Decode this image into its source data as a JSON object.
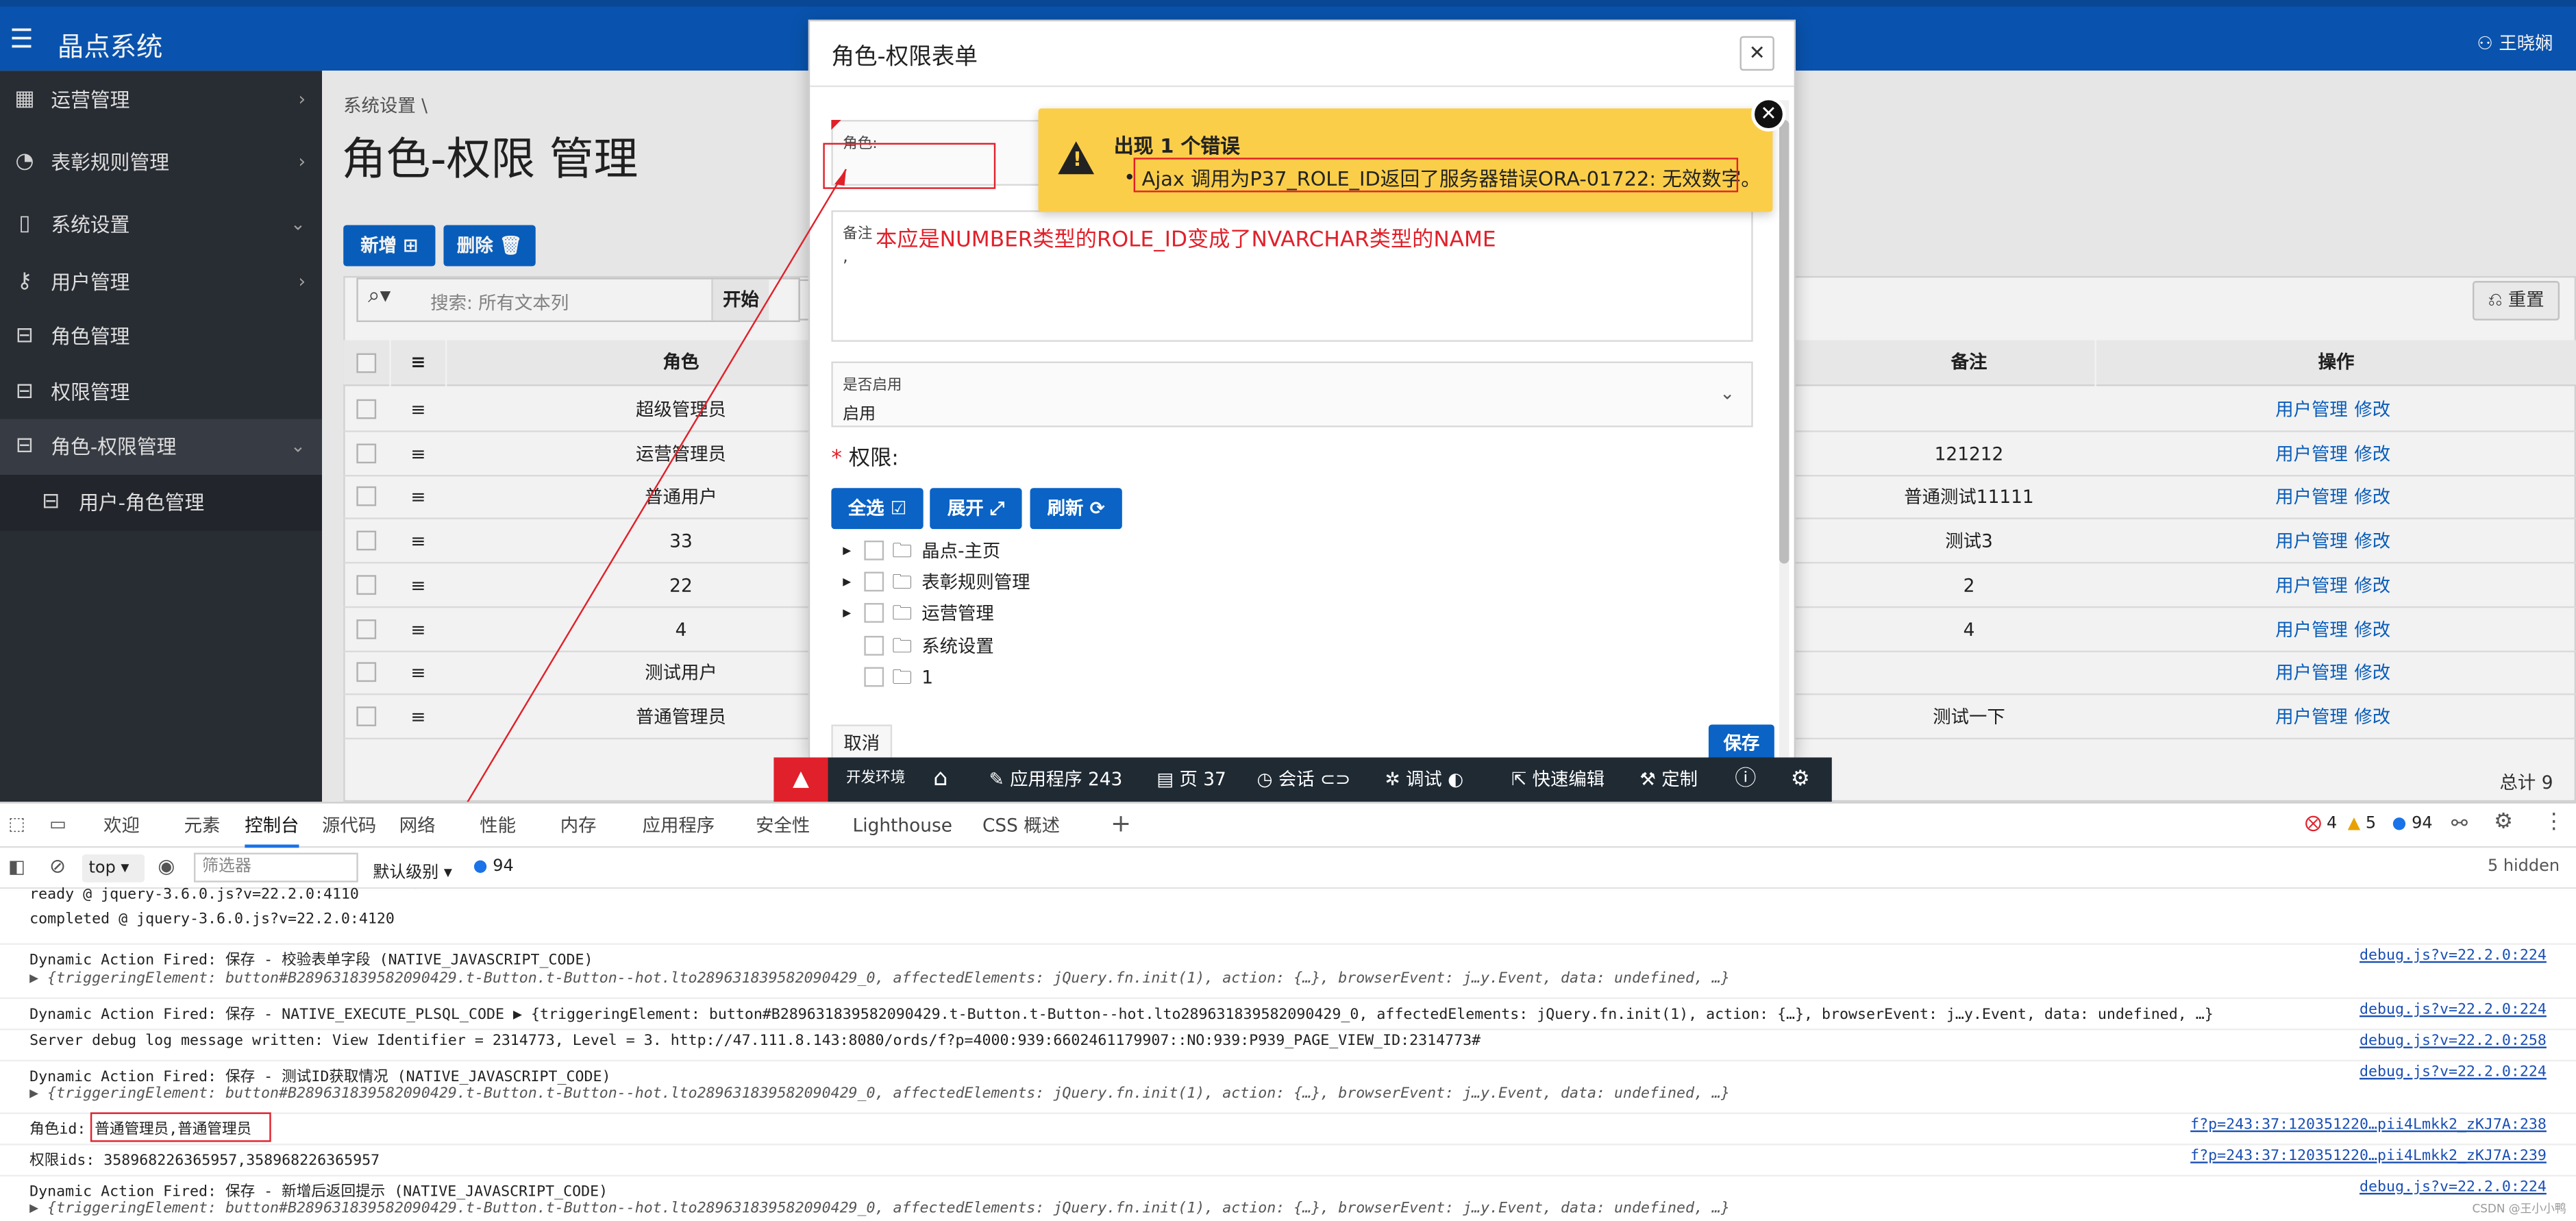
{
  "app": {
    "title": "晶点系统",
    "user": "王晓娴"
  },
  "sidebar": {
    "items": [
      {
        "label": "运营管理",
        "icon": "table-icon",
        "chev": "›"
      },
      {
        "label": "表彰规则管理",
        "icon": "gauge-icon",
        "chev": "›"
      },
      {
        "label": "系统设置",
        "icon": "document-icon",
        "chev": "⌄"
      },
      {
        "label": "用户管理",
        "icon": "user-key-icon",
        "chev": "›"
      },
      {
        "label": "角色管理",
        "icon": "form-icon",
        "chev": ""
      },
      {
        "label": "权限管理",
        "icon": "form-icon",
        "chev": ""
      },
      {
        "label": "角色-权限管理",
        "icon": "form-icon",
        "chev": "⌄"
      },
      {
        "label": "用户-角色管理",
        "icon": "form-icon",
        "chev": ""
      }
    ]
  },
  "page": {
    "breadcrumb": "系统设置",
    "breadcrumb_sep": "\\",
    "title": "角色-权限 管理",
    "new_button": "新增",
    "delete_button": "删除",
    "search_placeholder": "搜索: 所有文本列",
    "go_button": "开始",
    "reset_button": "重置",
    "total": "总计 9"
  },
  "table": {
    "headers": {
      "role": "角色",
      "remark": "备注",
      "ops": "操作"
    },
    "rows": [
      {
        "role": "超级管理员",
        "remark": "",
        "op1": "用户管理",
        "op2": "修改"
      },
      {
        "role": "运营管理员",
        "remark": "121212",
        "op1": "用户管理",
        "op2": "修改"
      },
      {
        "role": "普通用户",
        "remark": "普通测试11111",
        "op1": "用户管理",
        "op2": "修改"
      },
      {
        "role": "33",
        "remark": "测试3",
        "op1": "用户管理",
        "op2": "修改"
      },
      {
        "role": "22",
        "remark": "2",
        "op1": "用户管理",
        "op2": "修改"
      },
      {
        "role": "4",
        "remark": "4",
        "op1": "用户管理",
        "op2": "修改"
      },
      {
        "role": "测试用户",
        "remark": "",
        "op1": "用户管理",
        "op2": "修改"
      },
      {
        "role": "普通管理员",
        "remark": "测试一下",
        "op1": "用户管理",
        "op2": "修改"
      }
    ]
  },
  "modal": {
    "title": "角色-权限表单",
    "role_label": "角色:",
    "remark_label": "备注",
    "remark_value": ",",
    "enabled_label": "是否启用",
    "enabled_value": "启用",
    "perm_label": "权限:",
    "required_mark": "*",
    "btn_all": "全选",
    "btn_expand": "展开",
    "btn_refresh": "刷新",
    "cancel": "取消",
    "save": "保存",
    "tree": [
      "晶点-主页",
      "表彰规则管理",
      "运营管理",
      "系统设置",
      "1"
    ]
  },
  "annotation": {
    "text": "本应是NUMBER类型的ROLE_ID变成了NVARCHAR类型的NAME",
    "color": "#e0202a"
  },
  "alert": {
    "title": "出现 1 个错误",
    "message": "Ajax 调用为P37_ROLE_ID返回了服务器错误ORA-01722: 无效数字。",
    "bg": "#fbce4a"
  },
  "devbar": {
    "env": "开发环境",
    "app": "应用程序 243",
    "page": "页 37",
    "session": "会话",
    "debug": "调试",
    "quick_edit": "快速编辑",
    "customize": "定制"
  },
  "devtools": {
    "tabs": [
      "欢迎",
      "元素",
      "控制台",
      "源代码",
      "网络",
      "性能",
      "内存",
      "应用程序",
      "安全性",
      "Lighthouse",
      "CSS 概述"
    ],
    "errors": "4",
    "warnings": "5",
    "messages": "94",
    "context": "top",
    "filter_placeholder": "筛选器",
    "level": "默认级别",
    "msg_count": "94",
    "hidden": "5 hidden"
  },
  "console": [
    {
      "text": "  ready          @ jquery-3.6.0.js?v=22.2.0:4110",
      "src": ""
    },
    {
      "text": "  completed      @ jquery-3.6.0.js?v=22.2.0:4120",
      "src": ""
    },
    {
      "text": "Dynamic Action Fired: 保存 - 校验表单字段 (NATIVE_JAVASCRIPT_CODE)",
      "src": "debug.js?v=22.2.0:224"
    },
    {
      "text": "  ▶ {triggeringElement: button#B289631839582090429.t-Button.t-Button--hot.lto289631839582090429_0, affectedElements: jQuery.fn.init(1), action: {…}, browserEvent: j…y.Event, data: undefined, …}",
      "src": ""
    },
    {
      "text": "Dynamic Action Fired: 保存 - NATIVE_EXECUTE_PLSQL_CODE  ▶ {triggeringElement: button#B289631839582090429.t-Button.t-Button--hot.lto289631839582090429_0, affectedElements: jQuery.fn.init(1), action: {…}, browserEvent: j…y.Event, data: undefined, …}",
      "src": "debug.js?v=22.2.0:224"
    },
    {
      "text": "Server debug log message written: View Identifier = 2314773, Level = 3. http://47.111.8.143:8080/ords/f?p=4000:939:6602461179907::NO:939:P939_PAGE_VIEW_ID:2314773#",
      "src": "debug.js?v=22.2.0:258"
    },
    {
      "text": "Dynamic Action Fired: 保存 - 测试ID获取情况 (NATIVE_JAVASCRIPT_CODE)",
      "src": "debug.js?v=22.2.0:224"
    },
    {
      "text": "  ▶ {triggeringElement: button#B289631839582090429.t-Button.t-Button--hot.lto289631839582090429_0, affectedElements: jQuery.fn.init(1), action: {…}, browserEvent: j…y.Event, data: undefined, …}",
      "src": ""
    },
    {
      "text": "角色id: 普通管理员,普通管理员",
      "src": "f?p=243:37:120351220…pii4Lmkk2_zKJ7A:238"
    },
    {
      "text": "权限ids: 358968226365957,358968226365957",
      "src": "f?p=243:37:120351220…pii4Lmkk2_zKJ7A:239"
    },
    {
      "text": "Dynamic Action Fired: 保存 - 新增后返回提示 (NATIVE_JAVASCRIPT_CODE)",
      "src": "debug.js?v=22.2.0:224"
    },
    {
      "text": "  ▶ {triggeringElement: button#B289631839582090429.t-Button.t-Button--hot.lto289631839582090429_0, affectedElements: jQuery.fn.init(1), action: {…}, browserEvent: j…y.Event, data: undefined, …}",
      "src": ""
    }
  ],
  "watermark": "CSDN @王小小鸭"
}
